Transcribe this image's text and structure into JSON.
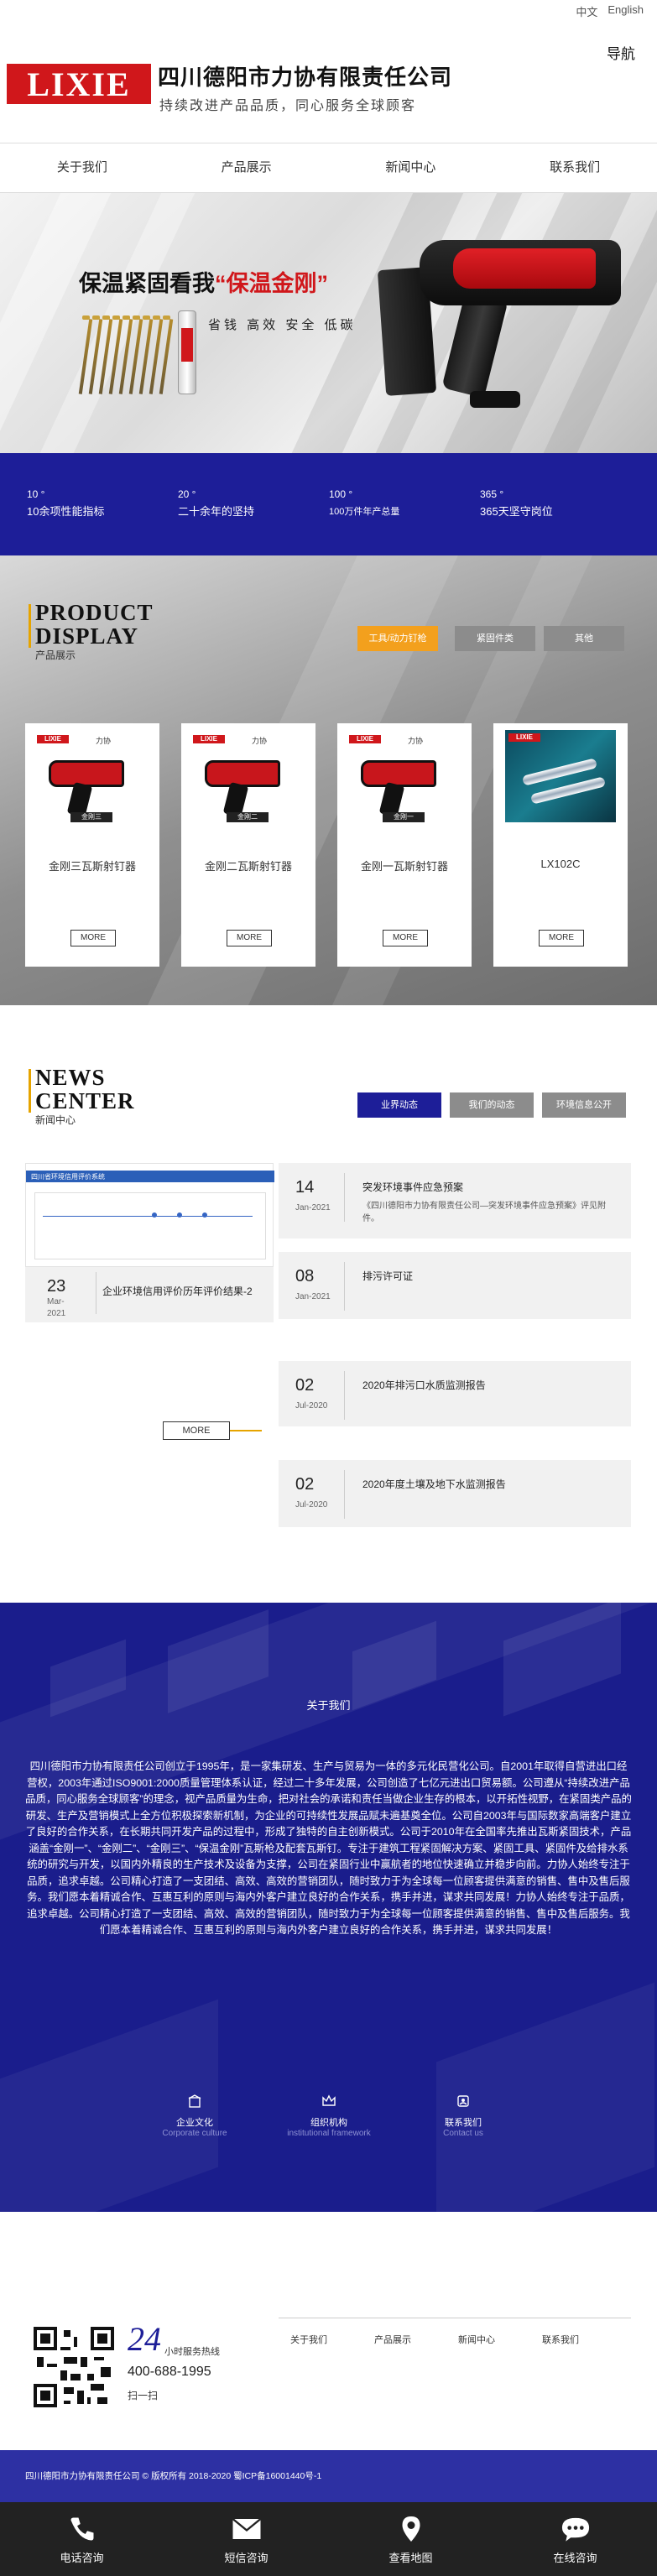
{
  "header": {
    "lang_cn": "中文",
    "lang_en": "English",
    "logo_text": "LIXIE",
    "company": "四川德阳市力协有限责任公司",
    "slogan": "持续改进产品品质，同心服务全球顾客",
    "nav_toggle": "导航"
  },
  "menu": [
    "关于我们",
    "产品展示",
    "新闻中心",
    "联系我们"
  ],
  "banner": {
    "headline_a": "保温紧固看我",
    "headline_b": "“保温金刚”",
    "sub": "省钱 高效 安全 低碳"
  },
  "stats": [
    {
      "value": "10 °",
      "label": "10余项性能指标"
    },
    {
      "value": "20 °",
      "label": "二十余年的坚持"
    },
    {
      "value": "100 °",
      "label": "100万件年产总量"
    },
    {
      "value": "365 °",
      "label": "365天坚守岗位"
    }
  ],
  "products": {
    "title_line1": "PRODUCT",
    "title_line2": "DISPLAY",
    "subtitle": "产品展示",
    "tabs": [
      "工具/动力钉枪",
      "紧固件类",
      "其他"
    ],
    "items": [
      {
        "name": "金刚三瓦斯射钉器",
        "badge": "金刚三",
        "brand": "LIXIE",
        "brand_cn": "力协",
        "more": "MORE"
      },
      {
        "name": "金刚二瓦斯射钉器",
        "badge": "金刚二",
        "brand": "LIXIE",
        "brand_cn": "力协",
        "more": "MORE"
      },
      {
        "name": "金刚一瓦斯射钉器",
        "badge": "金刚一",
        "brand": "LIXIE",
        "brand_cn": "力协",
        "more": "MORE"
      },
      {
        "name": "LX102C",
        "brand": "LIXIE",
        "more": "MORE"
      }
    ]
  },
  "news": {
    "title_line1": "NEWS",
    "title_line2": "CENTER",
    "subtitle": "新闻中心",
    "tabs": [
      "业界动态",
      "我们的动态",
      "环境信息公开"
    ],
    "featured": {
      "day": "23",
      "month": "Mar-",
      "year": "2021",
      "title": "企业环境信用评价历年评价结果-2",
      "img_header": "四川省环境信用评价系统"
    },
    "more": "MORE",
    "items": [
      {
        "day": "14",
        "month": "Jan-2021",
        "title": "突发环境事件应急预案",
        "desc": "《四川德阳市力协有限责任公司—突发环境事件应急预案》评见附件。"
      },
      {
        "day": "08",
        "month": "Jan-2021",
        "title": "排污许可证",
        "desc": ""
      },
      {
        "day": "02",
        "month": "Jul-2020",
        "title": "2020年排污口水质监测报告",
        "desc": ""
      },
      {
        "day": "02",
        "month": "Jul-2020",
        "title": "2020年度土壤及地下水监测报告",
        "desc": ""
      }
    ]
  },
  "about": {
    "title": "关于我们",
    "text": "四川德阳市力协有限责任公司创立于1995年，是一家集研发、生产与贸易为一体的多元化民营化公司。自2001年取得自营进出口经营权，2003年通过ISO9001:2000质量管理体系认证，经过二十多年发展，公司创造了七亿元进出口贸易额。公司遵从“持续改进产品品质，同心服务全球顾客”的理念，视产品质量为生命，把对社会的承诺和责任当做企业生存的根本，以开拓性视野，在紧固类产品的研发、生产及营销模式上全方位积极探索新机制，为企业的可持续性发展品赋未遍基奠全位。公司自2003年与国际数家高端客户建立了良好的合作关系，在长期共同开发产品的过程中，形成了独特的自主创新模式。公司于2010年在全国率先推出瓦斯紧固技术，产品涵盖“金刚一”、“金刚二”、“金刚三”、“保温金刚”瓦斯枪及配套瓦斯钉。专注于建筑工程紧固解决方案、紧固工具、紧固件及给排水系统的研究与开发，以国内外精良的生产技术及设备为支撑，公司在紧固行业中赢航者的地位快速确立并稳步向前。力协人始终专注于品质，追求卓越。公司精心打造了一支团结、高效、高效的营销团队，随时致力于为全球每一位顾客提供满意的销售、售中及售后服务。我们愿本着精诚合作、互惠互利的原则与海内外客户建立良好的合作关系，携手并进，谋求共同发展！力协人始终专注于品质，追求卓越。公司精心打造了一支团结、高效、高效的营销团队，随时致力于为全球每一位顾客提供满意的销售、售中及售后服务。我们愿本着精诚合作、互惠互利的原则与海内外客户建立良好的合作关系，携手并进，谋求共同发展！",
    "icons": [
      {
        "cn": "企业文化",
        "en": "Corporate culture"
      },
      {
        "cn": "组织机构",
        "en": "institutional framework"
      },
      {
        "cn": "联系我们",
        "en": "Contact us"
      }
    ]
  },
  "footer": {
    "hotline_num": "24",
    "hotline_label": "小时服务热线",
    "phone": "400-688-1995",
    "scan": "扫一扫",
    "links": [
      "关于我们",
      "产品展示",
      "新闻中心",
      "联系我们"
    ],
    "copyright": "四川德阳市力协有限责任公司 © 版权所有 2018-2020 蜀ICP备16001440号-1"
  },
  "bottom_bar": [
    {
      "label": "电话咨询",
      "icon": "phone-icon"
    },
    {
      "label": "短信咨询",
      "icon": "mail-icon"
    },
    {
      "label": "查看地图",
      "icon": "map-icon"
    },
    {
      "label": "在线咨询",
      "icon": "chat-icon"
    }
  ],
  "colors": {
    "brand_red": "#d0171b",
    "navy": "#1d1e98",
    "accent_orange": "#f3a01d",
    "gray_btn": "#8c8c8c"
  }
}
